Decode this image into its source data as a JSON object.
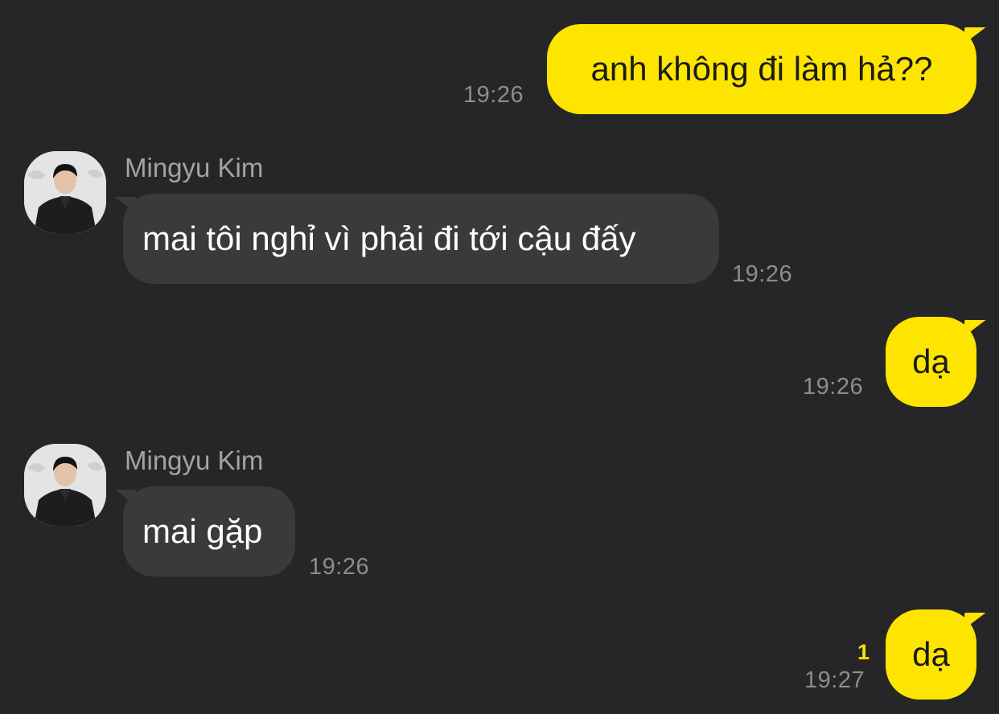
{
  "colors": {
    "background": "#262628",
    "outgoing_bubble": "#FEE500",
    "incoming_bubble": "#3a3a3d",
    "timestamp": "#8d8d90",
    "unread": "#FEE500"
  },
  "messages": [
    {
      "direction": "outgoing",
      "text": "anh không đi làm hả??",
      "time": "19:26"
    },
    {
      "direction": "incoming",
      "sender": "Mingyu Kim",
      "avatar_icon": "profile-photo",
      "text": "mai tôi nghỉ vì phải đi tới cậu đấy",
      "time": "19:26"
    },
    {
      "direction": "outgoing",
      "text": "dạ",
      "time": "19:26"
    },
    {
      "direction": "incoming",
      "sender": "Mingyu Kim",
      "avatar_icon": "profile-photo",
      "text": "mai gặp",
      "time": "19:26"
    },
    {
      "direction": "outgoing",
      "text": "dạ",
      "time": "19:27",
      "unread_count": "1"
    }
  ]
}
